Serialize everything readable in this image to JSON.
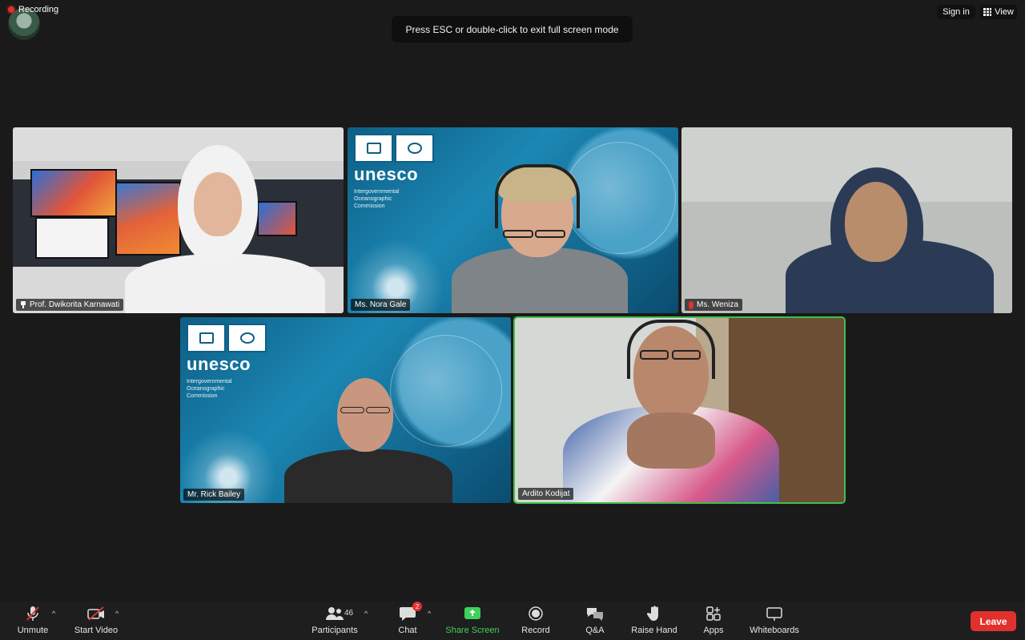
{
  "top_bar": {
    "recording_label": "Recording",
    "esc_message": "Press ESC or double-click to exit full screen mode",
    "sign_in_label": "Sign in",
    "view_label": "View"
  },
  "tiles": [
    {
      "name": "Prof. Dwikorita Karnawati",
      "pinned": true,
      "muted": false,
      "active": false
    },
    {
      "name": "Ms. Nora Gale",
      "pinned": false,
      "muted": false,
      "active": false
    },
    {
      "name": "Ms. Weniza",
      "pinned": false,
      "muted": true,
      "active": false
    },
    {
      "name": "Mr. Rick Bailey",
      "pinned": false,
      "muted": false,
      "active": false
    },
    {
      "name": "Ardito Kodijat",
      "pinned": false,
      "muted": false,
      "active": true
    }
  ],
  "unesco": {
    "word": "unesco",
    "subtitle": "Intergovernmental Oceanographic Commission"
  },
  "toolbar": {
    "unmute_label": "Unmute",
    "start_video_label": "Start Video",
    "participants_label": "Participants",
    "participants_count": "46",
    "chat_label": "Chat",
    "chat_badge": "2",
    "share_screen_label": "Share Screen",
    "record_label": "Record",
    "qa_label": "Q&A",
    "raise_hand_label": "Raise Hand",
    "apps_label": "Apps",
    "whiteboards_label": "Whiteboards",
    "leave_label": "Leave"
  },
  "colors": {
    "accent_green": "#3fd15a",
    "leave_red": "#e0312f",
    "active_speaker_border": "#3fbf4b"
  }
}
